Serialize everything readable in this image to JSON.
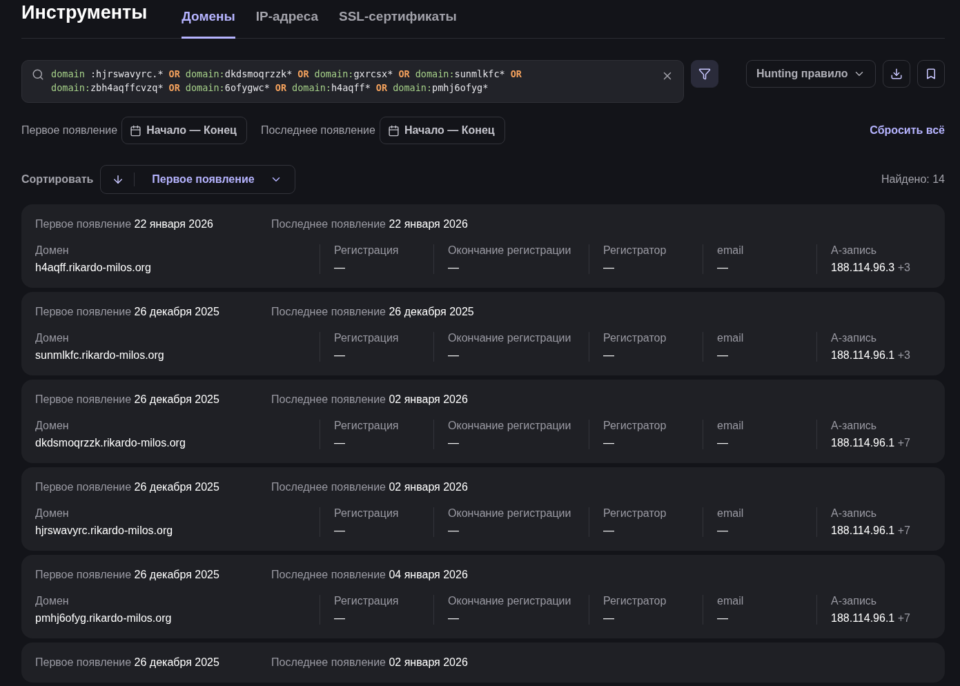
{
  "title": "Инструменты",
  "tabs": [
    {
      "label": "Домены",
      "selected": true
    },
    {
      "label": "IP-адреса",
      "selected": false
    },
    {
      "label": "SSL-сертификаты",
      "selected": false
    }
  ],
  "query": {
    "lines": [
      [
        {
          "kind": "field",
          "text": "domain"
        },
        {
          "kind": "value",
          "text": " :hjrswavyrc.*"
        },
        {
          "kind": "op",
          "text": "OR"
        },
        {
          "kind": "field",
          "text": "domain:"
        },
        {
          "kind": "value",
          "text": "dkdsmoqrzzk*"
        },
        {
          "kind": "op",
          "text": "OR"
        },
        {
          "kind": "field",
          "text": "domain:"
        },
        {
          "kind": "value",
          "text": "gxrcsx*"
        },
        {
          "kind": "op",
          "text": "OR"
        },
        {
          "kind": "field",
          "text": "domain:"
        },
        {
          "kind": "value",
          "text": "sunmlkfc*"
        },
        {
          "kind": "op",
          "text": "OR"
        }
      ],
      [
        {
          "kind": "field",
          "text": "domain:"
        },
        {
          "kind": "value",
          "text": "zbh4aqffcvzq*"
        },
        {
          "kind": "op",
          "text": "OR"
        },
        {
          "kind": "field",
          "text": "domain:"
        },
        {
          "kind": "value",
          "text": "6ofygwc*"
        },
        {
          "kind": "op",
          "text": "OR"
        },
        {
          "kind": "field",
          "text": "domain:"
        },
        {
          "kind": "value",
          "text": "h4aqff*"
        },
        {
          "kind": "op",
          "text": "OR"
        },
        {
          "kind": "field",
          "text": "domain:"
        },
        {
          "kind": "value",
          "text": "pmhj6ofyg*"
        }
      ]
    ]
  },
  "hunting_rule": "Hunting правило",
  "date_filters": [
    {
      "label": "Первое появление",
      "range": "Начало — Конец"
    },
    {
      "label": "Последнее появление",
      "range": "Начало — Конец"
    }
  ],
  "reset": "Сбросить всё",
  "sort": {
    "label": "Сортировать",
    "field": "Первое появление"
  },
  "found": "Найдено: 14",
  "results": [
    {
      "first_label": "Первое появление",
      "first": "22 января 2026",
      "last_label": "Последнее появление",
      "last": "22 января 2026",
      "fields": [
        {
          "label": "Домен",
          "value": "h4aqff.rikardo-milos.org"
        },
        {
          "label": "Регистрация",
          "value": "—"
        },
        {
          "label": "Окончание регистрации",
          "value": "—"
        },
        {
          "label": "Регистратор",
          "value": "—"
        },
        {
          "label": "email",
          "value": "—"
        },
        {
          "label": "A-запись",
          "value": "188.114.96.3",
          "extra": "+3"
        }
      ]
    },
    {
      "first_label": "Первое появление",
      "first": "26 декабря 2025",
      "last_label": "Последнее появление",
      "last": "26 декабря 2025",
      "fields": [
        {
          "label": "Домен",
          "value": "sunmlkfc.rikardo-milos.org"
        },
        {
          "label": "Регистрация",
          "value": "—"
        },
        {
          "label": "Окончание регистрации",
          "value": "—"
        },
        {
          "label": "Регистратор",
          "value": "—"
        },
        {
          "label": "email",
          "value": "—"
        },
        {
          "label": "A-запись",
          "value": "188.114.96.1",
          "extra": "+3"
        }
      ]
    },
    {
      "first_label": "Первое появление",
      "first": "26 декабря 2025",
      "last_label": "Последнее появление",
      "last": "02 января 2026",
      "fields": [
        {
          "label": "Домен",
          "value": "dkdsmoqrzzk.rikardo-milos.org"
        },
        {
          "label": "Регистрация",
          "value": "—"
        },
        {
          "label": "Окончание регистрации",
          "value": "—"
        },
        {
          "label": "Регистратор",
          "value": "—"
        },
        {
          "label": "email",
          "value": "—"
        },
        {
          "label": "A-запись",
          "value": "188.114.96.1",
          "extra": "+7"
        }
      ]
    },
    {
      "first_label": "Первое появление",
      "first": "26 декабря 2025",
      "last_label": "Последнее появление",
      "last": "02 января 2026",
      "fields": [
        {
          "label": "Домен",
          "value": "hjrswavyrc.rikardo-milos.org"
        },
        {
          "label": "Регистрация",
          "value": "—"
        },
        {
          "label": "Окончание регистрации",
          "value": "—"
        },
        {
          "label": "Регистратор",
          "value": "—"
        },
        {
          "label": "email",
          "value": "—"
        },
        {
          "label": "A-запись",
          "value": "188.114.96.1",
          "extra": "+7"
        }
      ]
    },
    {
      "first_label": "Первое появление",
      "first": "26 декабря 2025",
      "last_label": "Последнее появление",
      "last": "04 января 2026",
      "fields": [
        {
          "label": "Домен",
          "value": "pmhj6ofyg.rikardo-milos.org"
        },
        {
          "label": "Регистрация",
          "value": "—"
        },
        {
          "label": "Окончание регистрации",
          "value": "—"
        },
        {
          "label": "Регистратор",
          "value": "—"
        },
        {
          "label": "email",
          "value": "—"
        },
        {
          "label": "A-запись",
          "value": "188.114.96.1",
          "extra": "+7"
        }
      ]
    },
    {
      "first_label": "Первое появление",
      "first": "26 декабря 2025",
      "last_label": "Последнее появление",
      "last": "02 января 2026"
    }
  ]
}
